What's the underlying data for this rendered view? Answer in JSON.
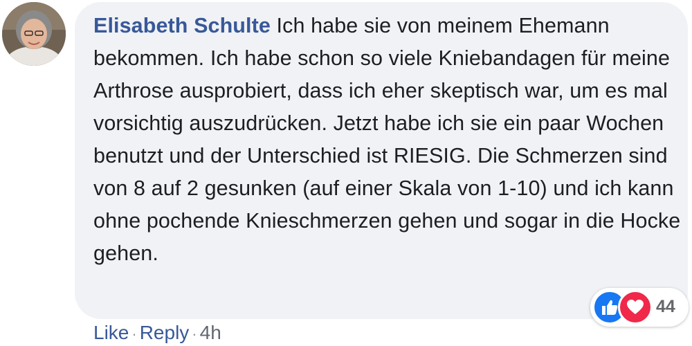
{
  "comment": {
    "author": "Elisabeth Schulte",
    "text": "Ich habe sie von meinem Ehemann bekommen. Ich habe schon so viele Kniebandagen für meine Arthrose ausprobiert, dass ich eher skeptisch war, um es mal vorsichtig auszudrücken. Jetzt habe ich sie ein paar Wochen benutzt und der Unterschied ist RIESIG. Die Schmerzen sind von 8 auf 2 gesunken (auf einer Skala von 1-10) und ich kann ohne pochende Knieschmerzen gehen und sogar in die Hocke gehen."
  },
  "reactions": {
    "icons": [
      "like-icon",
      "love-icon"
    ],
    "count": "44",
    "like_color": "#1877f2",
    "love_color": "#f02849"
  },
  "actions": {
    "like_label": "Like",
    "reply_label": "Reply",
    "separator": "·",
    "time": "4h"
  },
  "colors": {
    "link": "#385898",
    "bubble": "#f0f2f5",
    "text": "#1c1e21"
  }
}
